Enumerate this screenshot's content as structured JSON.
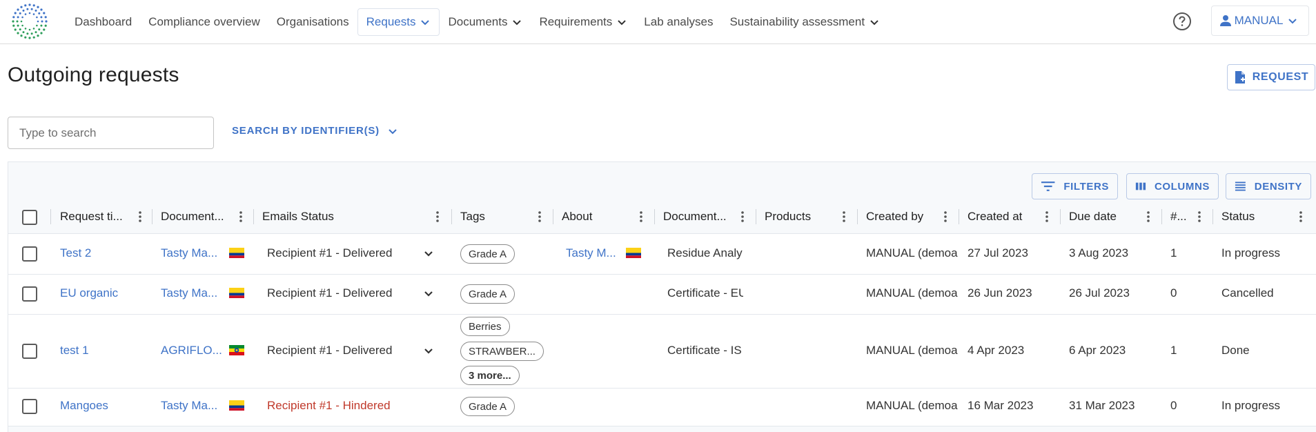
{
  "nav": {
    "items": [
      {
        "label": "Dashboard",
        "dropdown": false,
        "active": false
      },
      {
        "label": "Compliance overview",
        "dropdown": false,
        "active": false
      },
      {
        "label": "Organisations",
        "dropdown": false,
        "active": false
      },
      {
        "label": "Requests",
        "dropdown": true,
        "active": true
      },
      {
        "label": "Documents",
        "dropdown": true,
        "active": false
      },
      {
        "label": "Requirements",
        "dropdown": true,
        "active": false
      },
      {
        "label": "Lab analyses",
        "dropdown": false,
        "active": false
      },
      {
        "label": "Sustainability assessment",
        "dropdown": true,
        "active": false
      }
    ],
    "user_label": "MANUAL",
    "help_icon": "question-circle-icon"
  },
  "page": {
    "title": "Outgoing requests",
    "request_button": "REQUEST"
  },
  "search": {
    "placeholder": "Type to search",
    "identifier_label": "SEARCH BY IDENTIFIER(S)"
  },
  "toolbar": {
    "filters": "FILTERS",
    "columns": "COLUMNS",
    "density": "DENSITY"
  },
  "columns": [
    "Request ti...",
    "Document...",
    "Emails Status",
    "Tags",
    "About",
    "Document...",
    "Products",
    "Created by",
    "Created at",
    "Due date",
    "#...",
    "Status"
  ],
  "rows": [
    {
      "title": "Test 2",
      "document_org": "Tasty Ma...",
      "document_flag": "colombia",
      "email_status": "Recipient #1 - Delivered",
      "email_status_type": "delivered",
      "tags": [
        "Grade A"
      ],
      "about": "Tasty M...",
      "about_flag": "colombia",
      "document": "Residue Analy",
      "products": "",
      "created_by": "MANUAL (demoa",
      "created_at": "27 Jul 2023",
      "due_date": "3 Aug 2023",
      "count": "1",
      "status": "In progress"
    },
    {
      "title": "EU organic",
      "document_org": "Tasty Ma...",
      "document_flag": "colombia",
      "email_status": "Recipient #1 - Delivered",
      "email_status_type": "delivered",
      "tags": [
        "Grade A"
      ],
      "about": "",
      "about_flag": "",
      "document": "Certificate - EU",
      "products": "",
      "created_by": "MANUAL (demoa",
      "created_at": "26 Jun 2023",
      "due_date": "26 Jul 2023",
      "count": "0",
      "status": "Cancelled"
    },
    {
      "title": "test 1",
      "document_org": "AGRIFLO...",
      "document_flag": "ethiopia",
      "email_status": "Recipient #1 - Delivered",
      "email_status_type": "delivered",
      "tags": [
        "Berries",
        "STRAWBER..."
      ],
      "tags_more": "3 more...",
      "about": "",
      "about_flag": "",
      "document": "Certificate - IS",
      "products": "",
      "created_by": "MANUAL (demoa",
      "created_at": "4 Apr 2023",
      "due_date": "6 Apr 2023",
      "count": "1",
      "status": "Done"
    },
    {
      "title": "Mangoes",
      "document_org": "Tasty Ma...",
      "document_flag": "colombia",
      "email_status": "Recipient #1 - Hindered",
      "email_status_type": "hindered",
      "tags": [
        "Grade A"
      ],
      "about": "",
      "about_flag": "",
      "document": "",
      "products": "",
      "created_by": "MANUAL (demoa",
      "created_at": "16 Mar 2023",
      "due_date": "31 Mar 2023",
      "count": "0",
      "status": "In progress"
    }
  ],
  "colors": {
    "accent": "#3f73c7",
    "danger": "#c0392b",
    "text": "#212121"
  }
}
